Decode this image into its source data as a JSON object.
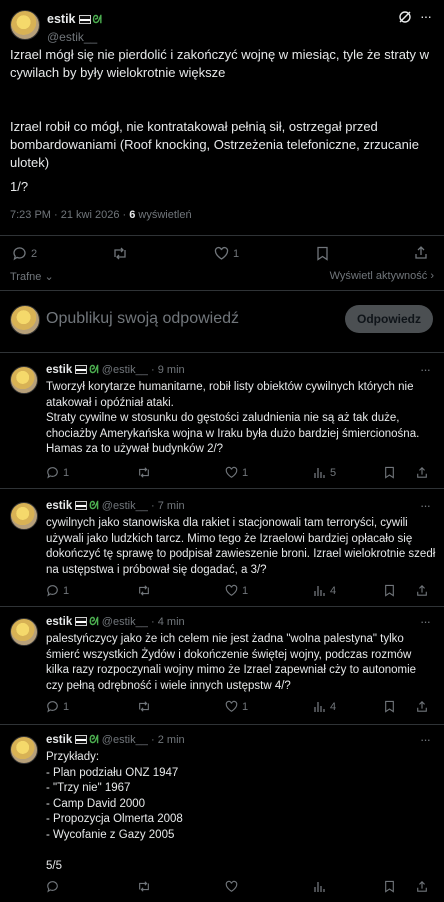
{
  "main_post": {
    "author_name": "estik",
    "author_handle": "@estik__",
    "paragraph1": "Izrael mógł się nie pierdolić i zakończyć wojnę w miesiąc, tyle że straty w cywilach by były wielokrotnie większe",
    "paragraph2": "Izrael robił co mógł, nie kontratakował pełnią sił, ostrzegał przed bombardowaniami (Roof knocking, Ostrzeżenia telefoniczne, zrzucanie ulotek)",
    "paragraph3": "1/?",
    "time": "7:23 PM · 21 kwi 2026 · ",
    "views_count": "6",
    "views_label": " wyświetleń",
    "replies": "2",
    "likes": "1",
    "sort_label": "Trafne",
    "activity_label": "Wyświetl aktywność"
  },
  "composer": {
    "placeholder": "Opublikuj swoją odpowiedź",
    "button": "Odpowiedz"
  },
  "replies": [
    {
      "name": "estik",
      "handle": "@estik__",
      "time": "· 9 min",
      "text": "Tworzył korytarze humanitarne, robił listy obiektów cywilnych których nie atakował i opóźniał ataki.\nStraty cywilne w stosunku do gęstości zaludnienia nie są aż tak duże, chociażby Amerykańska wojna w Iraku była dużo bardziej śmiercionośna.\nHamas za to używał budynków 2/?",
      "replies": "1",
      "likes": "1",
      "views": "5"
    },
    {
      "name": "estik",
      "handle": "@estik__",
      "time": "· 7 min",
      "text": "cywilnych jako stanowiska dla rakiet i stacjonowali tam terroryści, cywili używali jako ludzkich tarcz. Mimo tego że Izraelowi bardziej opłacało się dokończyć tę sprawę to podpisał zawieszenie broni. Izrael wielokrotnie szedł na ustępstwa i próbował się dogadać, a 3/?",
      "replies": "1",
      "likes": "1",
      "views": "4"
    },
    {
      "name": "estik",
      "handle": "@estik__",
      "time": "· 4 min",
      "text": "palestyńczycy jako że ich celem nie jest żadna \"wolna palestyna\" tylko śmierć wszystkich Żydów i dokończenie świętej wojny, podczas rozmów kilka razy rozpoczynali wojny mimo że Izrael zapewniał cży to autonomie czy pełną odrębność i wiele innych ustępstw 4/?",
      "replies": "1",
      "likes": "1",
      "views": "4"
    },
    {
      "name": "estik",
      "handle": "@estik__",
      "time": "· 2 min",
      "text": "Przykłady:\n- Plan podziału ONZ 1947\n- \"Trzy nie\" 1967\n- Camp David 2000\n- Propozycja Olmerta 2008\n- Wycofanie z Gazy 2005\n\n5/5",
      "replies": "",
      "likes": "",
      "views": ""
    }
  ]
}
